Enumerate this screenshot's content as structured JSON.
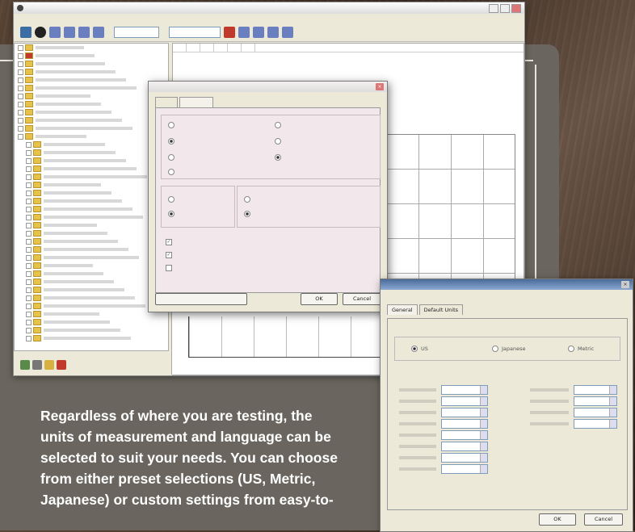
{
  "colors": {
    "panel": "#6a665f",
    "accent_red": "#c0392b",
    "caption_text": "#ffffff"
  },
  "main_window": {
    "title": "",
    "toolbar": {
      "field1_label": "",
      "field1_value": "",
      "field2_label": "",
      "field2_value": ""
    },
    "tree_rows": [
      "",
      "",
      "",
      "",
      "",
      "",
      "",
      "",
      "",
      "",
      "",
      "",
      "",
      "",
      "",
      "",
      "",
      "",
      "",
      "",
      "",
      "",
      "",
      "",
      "",
      "",
      "",
      "",
      "",
      "",
      "",
      "",
      "",
      "",
      "",
      "",
      ""
    ],
    "graph_title": ""
  },
  "options_dialog": {
    "title": "",
    "tabs": [
      "",
      ""
    ],
    "ok_label": "OK",
    "cancel_label": "Cancel",
    "reset_label": ""
  },
  "units_dialog": {
    "title": "",
    "tabs": [
      "General",
      "Default Units"
    ],
    "preset_group_label": "",
    "preset_options": [
      "US",
      "Japanese",
      "Metric"
    ],
    "ok_label": "OK",
    "cancel_label": "Cancel"
  },
  "caption": {
    "line1": "Regardless of where you are testing, the",
    "line2": "units of measurement and language can be",
    "line3": "selected to suit your needs. You can choose",
    "line4": "from either preset selections (US, Metric,",
    "line5": "Japanese) or custom settings from easy-to-"
  }
}
